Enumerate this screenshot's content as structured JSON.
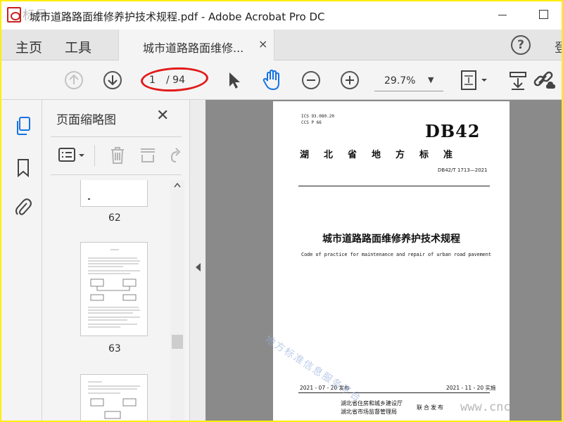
{
  "window": {
    "title": "城市道路路面维修养护技术规程.pdf - Adobe Acrobat Pro DC",
    "watermark_top": "标号"
  },
  "tabs": {
    "home": "主页",
    "tools": "工具",
    "document": "城市道路路面维修...",
    "close_symbol": "×",
    "help_symbol": "?",
    "partial_right": "登"
  },
  "toolbar": {
    "page_current": "1",
    "page_total": "/ 94",
    "zoom": "29.7%",
    "zoom_caret": "▼"
  },
  "panel": {
    "title": "页面缩略图",
    "close_symbol": "✕",
    "thumbnails": [
      {
        "label": "62"
      },
      {
        "label": "63"
      }
    ]
  },
  "document": {
    "ics": "ICS  93.080.20",
    "ccs": "CCS  P 66",
    "code": "DB42",
    "standard_type": "湖北省地方标准",
    "standard_no": "DB42/T 1713—2021",
    "title_cn": "城市道路路面维修养护技术规程",
    "title_en": "Code of practice for maintenance and repair of urban road pavement",
    "watermark": "地方标准信息服务平台",
    "date_published": "2021 - 07 - 20 发布",
    "date_implemented": "2021 - 11 - 20 实施",
    "issuer_1": "湖北省住房和城乡建设厅",
    "issuer_2": "湖北省市场监督管理局",
    "issue_action": "联合发布"
  },
  "overlay": {
    "url_watermark": "www.cnc"
  },
  "colors": {
    "border": "#ffee00",
    "highlight": "#e21a1a",
    "toolbar_bg": "#f4f4f4",
    "accent_blue": "#1473e6"
  }
}
